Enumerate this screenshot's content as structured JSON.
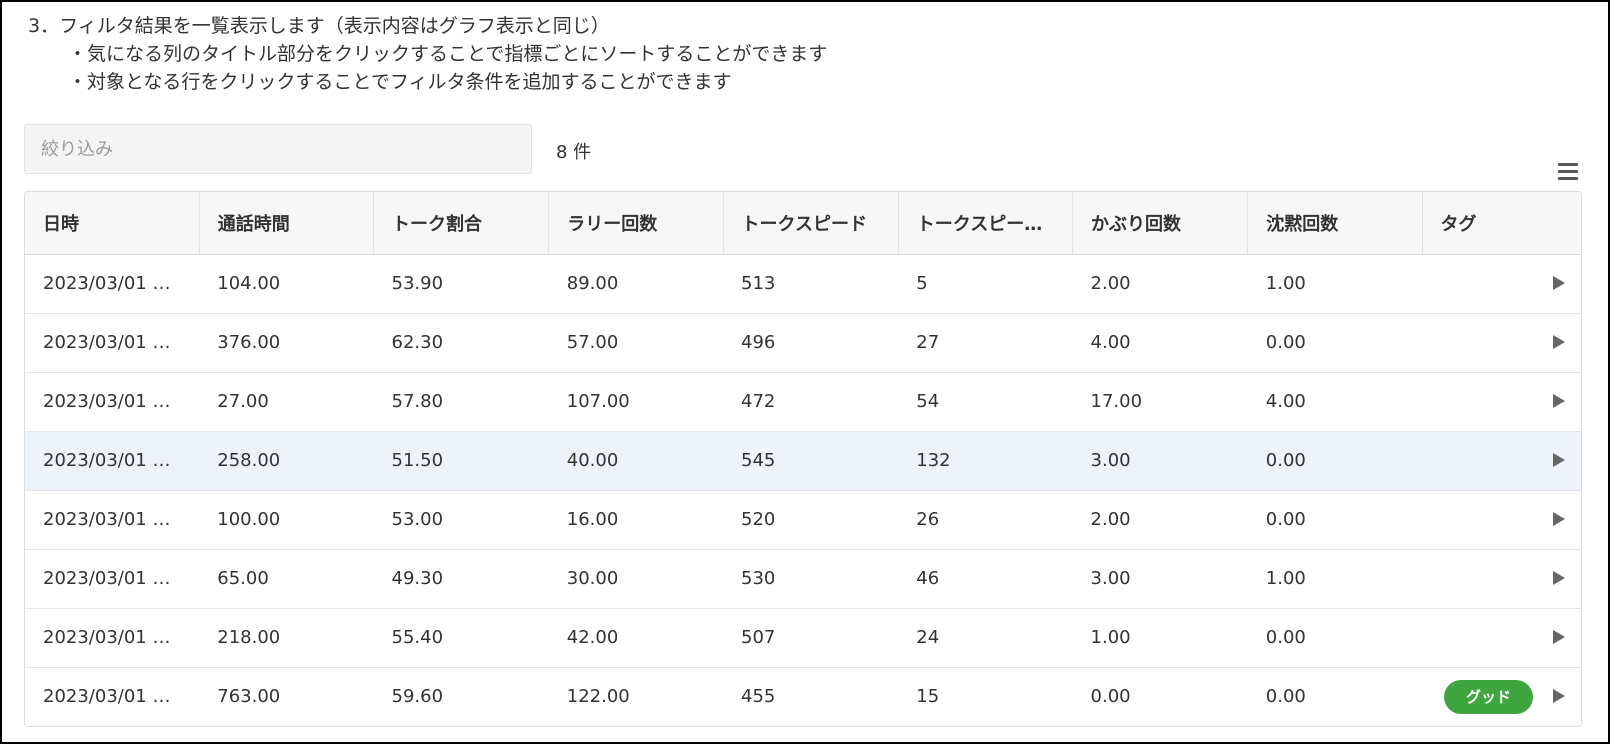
{
  "instructions": {
    "heading": "3．フィルタ結果を一覧表示します（表示内容はグラフ表示と同じ）",
    "bullet1": "・気になる列のタイトル部分をクリックすることで指標ごとにソートすることができます",
    "bullet2": "・対象となる行をクリックすることでフィルタ条件を追加することができます"
  },
  "filter": {
    "placeholder": "絞り込み",
    "value": "",
    "count_label": "8 件"
  },
  "menu": {
    "icon": "hamburger-menu-icon"
  },
  "table": {
    "columns": [
      "日時",
      "通話時間",
      "トーク割合",
      "ラリー回数",
      "トークスピード",
      "トークスピー…",
      "かぶり回数",
      "沈黙回数",
      "タグ"
    ],
    "rows": [
      {
        "cells": [
          "2023/03/01 …",
          "104.00",
          "53.90",
          "89.00",
          "513",
          "5",
          "2.00",
          "1.00"
        ],
        "tag": ""
      },
      {
        "cells": [
          "2023/03/01 …",
          "376.00",
          "62.30",
          "57.00",
          "496",
          "27",
          "4.00",
          "0.00"
        ],
        "tag": ""
      },
      {
        "cells": [
          "2023/03/01 …",
          "27.00",
          "57.80",
          "107.00",
          "472",
          "54",
          "17.00",
          "4.00"
        ],
        "tag": ""
      },
      {
        "cells": [
          "2023/03/01 …",
          "258.00",
          "51.50",
          "40.00",
          "545",
          "132",
          "3.00",
          "0.00"
        ],
        "tag": "",
        "highlighted": true
      },
      {
        "cells": [
          "2023/03/01 …",
          "100.00",
          "53.00",
          "16.00",
          "520",
          "26",
          "2.00",
          "0.00"
        ],
        "tag": ""
      },
      {
        "cells": [
          "2023/03/01 …",
          "65.00",
          "49.30",
          "30.00",
          "530",
          "46",
          "3.00",
          "1.00"
        ],
        "tag": ""
      },
      {
        "cells": [
          "2023/03/01 …",
          "218.00",
          "55.40",
          "42.00",
          "507",
          "24",
          "1.00",
          "0.00"
        ],
        "tag": ""
      },
      {
        "cells": [
          "2023/03/01 …",
          "763.00",
          "59.60",
          "122.00",
          "455",
          "15",
          "0.00",
          "0.00"
        ],
        "tag": "グッド"
      }
    ]
  },
  "colors": {
    "tag_badge": "#3fa53f",
    "row_highlight": "#eef2fb",
    "header_bg": "#f7f7f7"
  }
}
